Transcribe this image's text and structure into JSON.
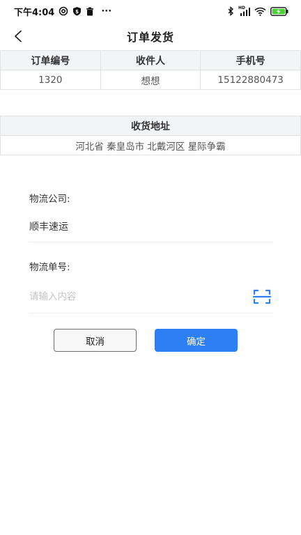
{
  "status_bar": {
    "time": "下午4:04",
    "more": "···",
    "network": "HD",
    "battery_color": "#4cd137"
  },
  "nav": {
    "title": "订单发货"
  },
  "order_table": {
    "headers": [
      "订单编号",
      "收件人",
      "手机号"
    ],
    "row": [
      "1320",
      "想想",
      "15122880473"
    ]
  },
  "address_table": {
    "header": "收货地址",
    "value": "河北省 秦皇岛市 北戴河区 星际争霸"
  },
  "form": {
    "company_label": "物流公司:",
    "company_value": "顺丰速运",
    "tracking_label": "物流单号:",
    "tracking_placeholder": "请输入内容",
    "tracking_value": ""
  },
  "buttons": {
    "cancel": "取消",
    "confirm": "确定"
  },
  "colors": {
    "accent": "#2d7ff3",
    "header_bg": "#f3f4f6"
  },
  "icons": {
    "back": "chevron-left-icon",
    "scan": "scan-icon"
  }
}
